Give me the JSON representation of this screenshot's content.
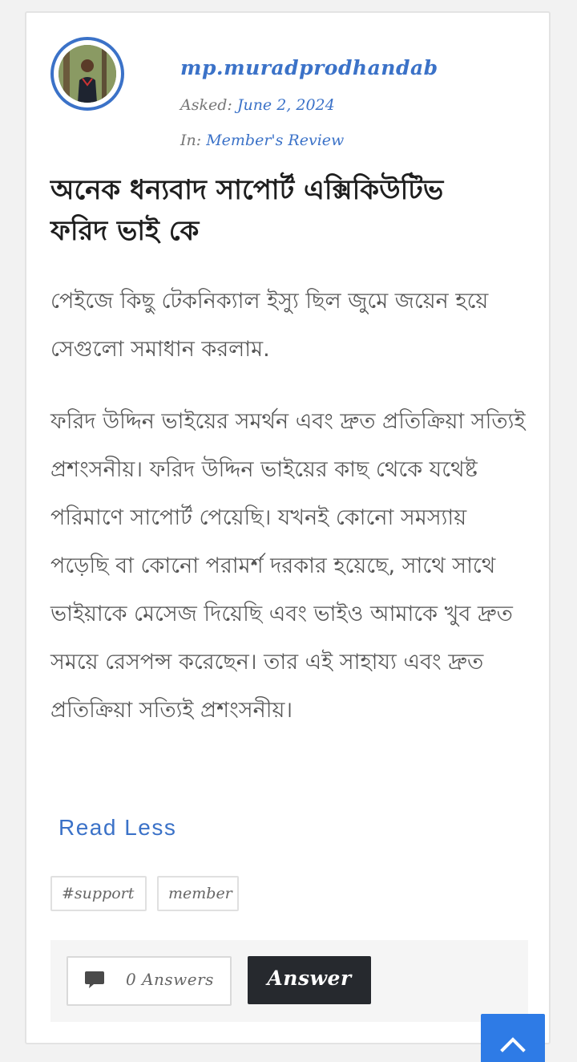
{
  "author": {
    "username": "mp.muradprodhandab",
    "asked_label": "Asked:",
    "asked_date": "June 2, 2024",
    "in_label": "In:",
    "category": "Member's Review"
  },
  "question": {
    "title": "অনেক ধন্যবাদ সাপোর্ট এক্সিকিউটিভ ফরিদ ভাই কে",
    "paragraphs": [
      "পেইজে কিছু টেকনিক্যাল ইস্যু ছিল জুমে জয়েন হয়ে সেগুলো সমাধান করলাম.",
      "ফরিদ উদ্দিন ভাইয়ের সমর্থন এবং দ্রুত প্রতিক্রিয়া সত্যিই প্রশংসনীয়। ফরিদ উদ্দিন ভাইয়ের কাছ থেকে যথেষ্ট পরিমাণে সাপোর্ট পেয়েছি। যখনই কোনো সমস্যায় পড়েছি বা কোনো পরামর্শ দরকার হয়েছে, সাথে সাথে ভাইয়াকে মেসেজ দিয়েছি এবং ভাইও আমাকে খুব দ্রুত সময়ে রেসপন্স করেছেন। তার এই সাহায্য এবং দ্রুত প্রতিক্রিয়া সত্যিই প্রশংসনীয়।"
    ],
    "read_less_label": "Read Less"
  },
  "tags": [
    "#support",
    "member"
  ],
  "footer": {
    "answers_label": "0 Answers",
    "answer_button_label": "Answer"
  },
  "icons": {
    "comment": "comment-icon",
    "scroll_top": "chevron-up-icon"
  },
  "colors": {
    "accent": "#3b72c8",
    "scroll_button": "#2e7be6",
    "answer_button": "#26292e"
  }
}
